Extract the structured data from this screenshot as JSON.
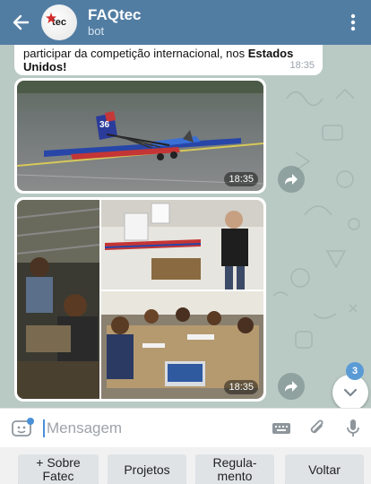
{
  "header": {
    "title": "FAQtec",
    "subtitle": "bot",
    "avatar_logo_text": "tec",
    "color": "#527da3"
  },
  "messages": {
    "text_message": {
      "line1": "participar da competição internacional, nos ",
      "bold1": "Estados",
      "bold2": "Unidos",
      "after_bold": "!",
      "time": "18:35"
    },
    "photo1": {
      "time": "18:35",
      "description_icon": "airplane-photo"
    },
    "photo2": {
      "time": "18:35",
      "description_icon": "team-collage-photo"
    }
  },
  "scroll": {
    "unread_count": "3"
  },
  "input": {
    "placeholder": "Mensagem"
  },
  "keyboard": {
    "buttons": [
      {
        "label": "+ Sobre\nFatec"
      },
      {
        "label": "Projetos"
      },
      {
        "label": "Regula-\nmento"
      },
      {
        "label": "Voltar"
      }
    ]
  },
  "icons": {
    "back": "arrow-left-icon",
    "menu": "kebab-menu-icon",
    "share": "forward-icon",
    "scroll_down": "chevron-down-icon",
    "sticker": "sticker-icon",
    "keyboard": "keyboard-icon",
    "attach": "paperclip-icon",
    "mic": "microphone-icon"
  }
}
